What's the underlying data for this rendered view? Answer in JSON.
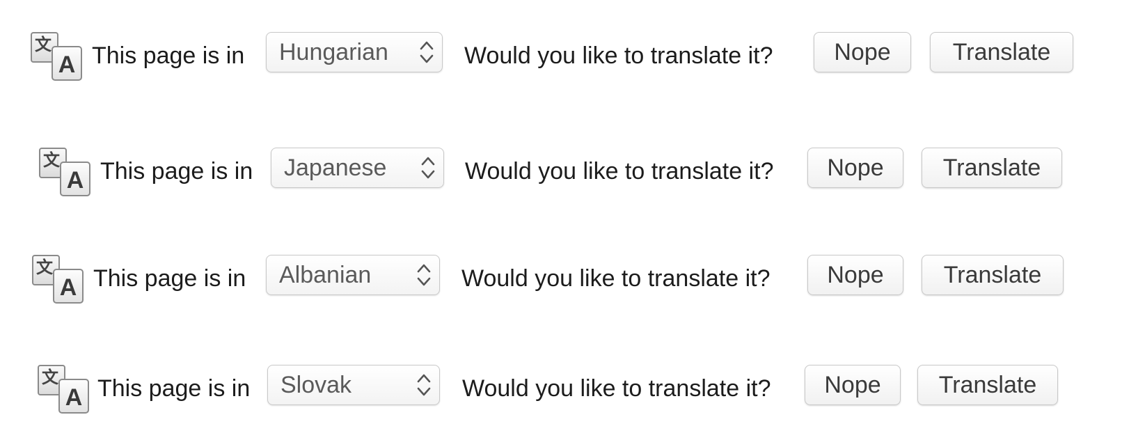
{
  "bars": [
    {
      "icon_glyphs": {
        "back": "文",
        "front": "A"
      },
      "prefix": "This page is in",
      "language": "Hungarian",
      "question": "Would you like to translate it?",
      "nope_label": "Nope",
      "translate_label": "Translate"
    },
    {
      "icon_glyphs": {
        "back": "文",
        "front": "A"
      },
      "prefix": "This page is in",
      "language": "Japanese",
      "question": "Would you like to translate it?",
      "nope_label": "Nope",
      "translate_label": "Translate"
    },
    {
      "icon_glyphs": {
        "back": "文",
        "front": "A"
      },
      "prefix": "This page is in",
      "language": "Albanian",
      "question": "Would you like to translate it?",
      "nope_label": "Nope",
      "translate_label": "Translate"
    },
    {
      "icon_glyphs": {
        "back": "文",
        "front": "A"
      },
      "prefix": "This page is in",
      "language": "Slovak",
      "question": "Would you like to translate it?",
      "nope_label": "Nope",
      "translate_label": "Translate"
    }
  ],
  "icons": {
    "translate": "translate-icon",
    "select_arrows": "chevron-up-down-icon"
  }
}
